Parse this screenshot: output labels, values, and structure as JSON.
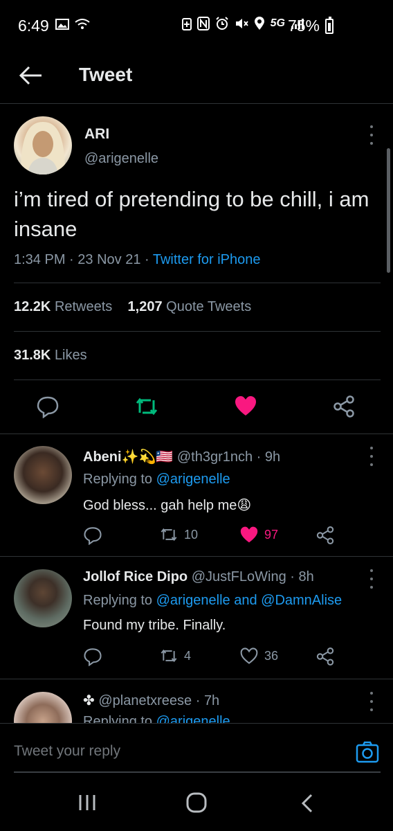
{
  "status_bar": {
    "time": "6:49",
    "network": "5G",
    "battery": "75%"
  },
  "header": {
    "title": "Tweet"
  },
  "tweet": {
    "author_name": "ARI",
    "author_handle": "@arigenelle",
    "text": "i’m tired of pretending to be chill, i am insane",
    "time": "1:34 PM",
    "date": "23 Nov 21",
    "source": "Twitter for iPhone",
    "retweets_count": "12.2K",
    "retweets_label": "Retweets",
    "quotes_count": "1,207",
    "quotes_label": "Quote Tweets",
    "likes_count": "31.8K",
    "likes_label": "Likes"
  },
  "replies": [
    {
      "name": "Abeni",
      "name_emoji": "✨💫🇱🇷",
      "handle": "@th3gr1nch",
      "age": "9h",
      "replying_prefix": "Replying to",
      "replying_to": "@arigenelle",
      "text": "God bless... gah help me😩",
      "retweets": "10",
      "likes": "97",
      "liked": true
    },
    {
      "name": "Jollof Rice Dipo",
      "handle": "@JustFLoWing",
      "age": "8h",
      "replying_prefix": "Replying to",
      "replying_to": "@arigenelle and @DamnAlise",
      "text": "Found my tribe. Finally.",
      "retweets": "4",
      "likes": "36",
      "liked": false
    },
    {
      "name": "✤",
      "handle": "@planetxreese",
      "age": "7h",
      "replying_prefix": "Replying to",
      "replying_to": "@arigenelle"
    }
  ],
  "composer": {
    "placeholder": "Tweet your reply"
  },
  "colors": {
    "accent": "#1d9bf0",
    "retweet_green": "#00ba7c",
    "like_pink": "#f91880",
    "background": "#000000"
  }
}
